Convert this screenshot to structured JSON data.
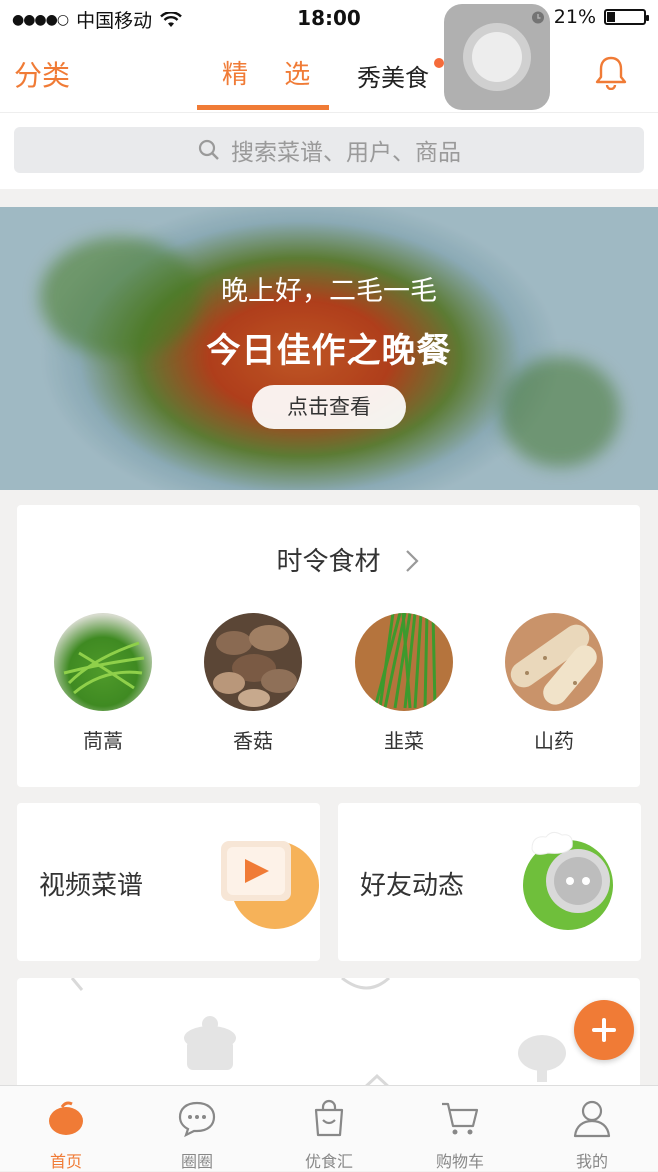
{
  "status_bar": {
    "carrier": "中国移动",
    "time": "18:00",
    "battery": "21%",
    "battery_level": 0.21
  },
  "top_nav": {
    "left_label": "分类",
    "tabs": [
      {
        "label": "精 选",
        "active": true
      },
      {
        "label": "秀美食",
        "active": false
      }
    ]
  },
  "search": {
    "placeholder": "搜索菜谱、用户、商品"
  },
  "banner": {
    "greeting": "晚上好，二毛一毛",
    "title": "今日佳作之晚餐",
    "button": "点击查看"
  },
  "seasonal": {
    "title": "时令食材",
    "items": [
      {
        "label": "茼蒿"
      },
      {
        "label": "香菇"
      },
      {
        "label": "韭菜"
      },
      {
        "label": "山药"
      }
    ]
  },
  "features": [
    {
      "label": "视频菜谱"
    },
    {
      "label": "好友动态"
    }
  ],
  "tab_bar": [
    {
      "label": "首页",
      "icon": "home-icon",
      "active": true
    },
    {
      "label": "圈圈",
      "icon": "chat-icon",
      "active": false
    },
    {
      "label": "优食汇",
      "icon": "shopping-bag-icon",
      "active": false
    },
    {
      "label": "购物车",
      "icon": "cart-icon",
      "active": false
    },
    {
      "label": "我的",
      "icon": "user-icon",
      "active": false
    }
  ],
  "colors": {
    "accent": "#f07b36",
    "dot": "#f56b3a"
  }
}
